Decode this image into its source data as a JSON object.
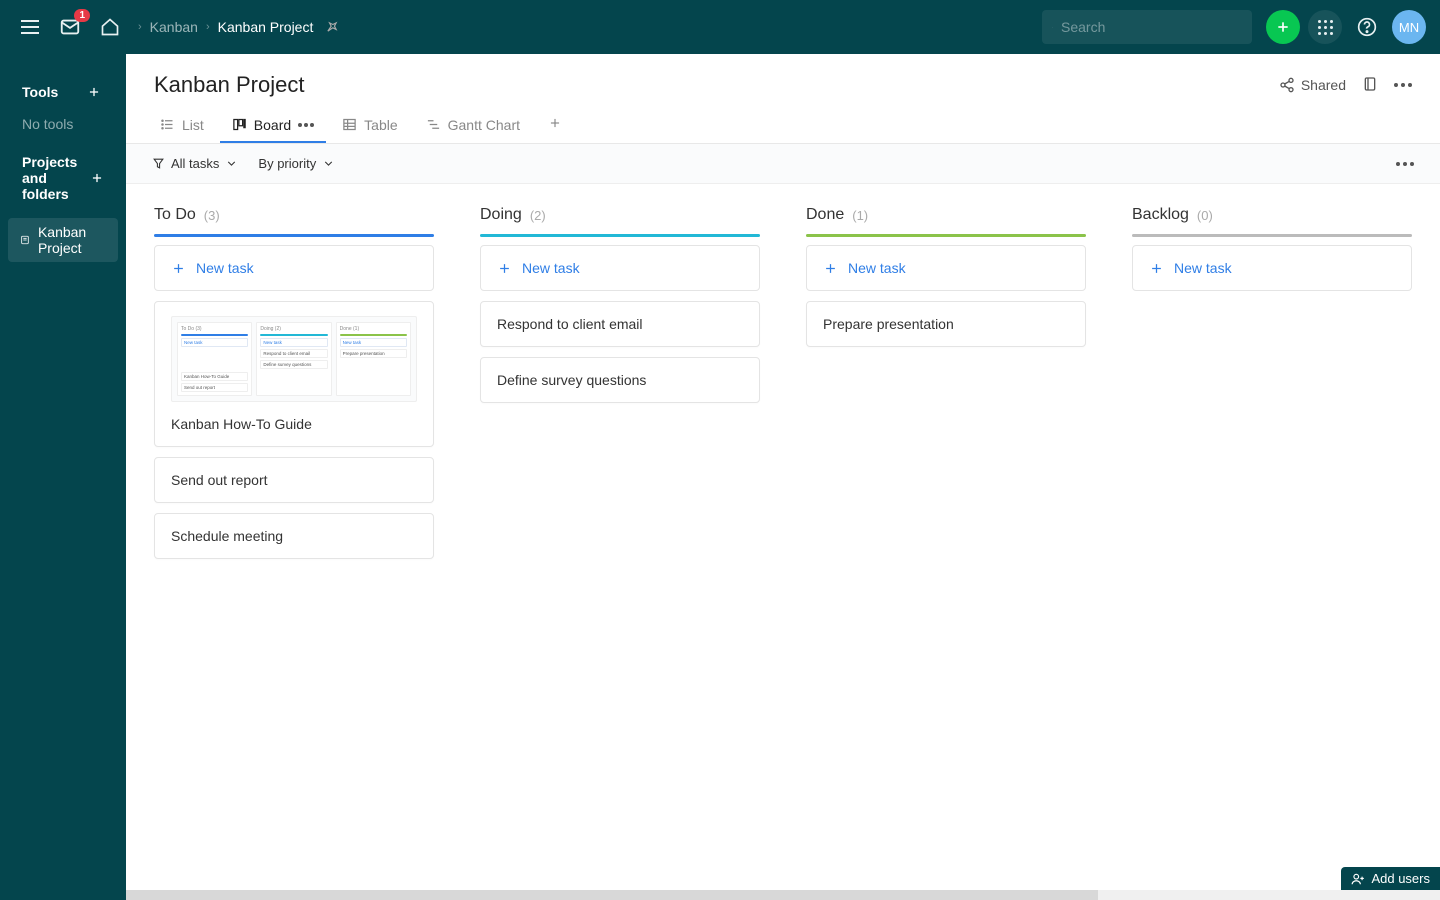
{
  "topbar": {
    "mail_badge": "1",
    "search_placeholder": "Search",
    "avatar_initials": "MN"
  },
  "breadcrumb": {
    "parent": "Kanban",
    "current": "Kanban Project"
  },
  "sidebar": {
    "tools_header": "Tools",
    "no_tools": "No tools",
    "projects_header": "Projects and folders",
    "items": [
      {
        "label": "Kanban Project"
      }
    ]
  },
  "page_title": "Kanban Project",
  "shared_label": "Shared",
  "view_tabs": {
    "list": "List",
    "board": "Board",
    "table": "Table",
    "gantt": "Gantt Chart"
  },
  "filters": {
    "all_tasks": "All tasks",
    "by_priority": "By priority"
  },
  "new_task_label": "New task",
  "columns": {
    "todo": {
      "title": "To Do",
      "count": "(3)"
    },
    "doing": {
      "title": "Doing",
      "count": "(2)"
    },
    "done": {
      "title": "Done",
      "count": "(1)"
    },
    "backlog": {
      "title": "Backlog",
      "count": "(0)"
    }
  },
  "cards": {
    "todo": [
      "Kanban How-To Guide",
      "Send out report",
      "Schedule meeting"
    ],
    "doing": [
      "Respond to client email",
      "Define survey questions"
    ],
    "done": [
      "Prepare presentation"
    ]
  },
  "thumb": {
    "c1_head": "To Do (3)",
    "c1_card1": "Kanban How-To Guide",
    "c1_card2": "Send out report",
    "c2_head": "Doing (2)",
    "c2_card1": "Respond to client email",
    "c2_card2": "Define survey questions",
    "c3_head": "Done (1)",
    "c3_card1": "Prepare presentation"
  },
  "footer": {
    "add_users": "Add users"
  }
}
